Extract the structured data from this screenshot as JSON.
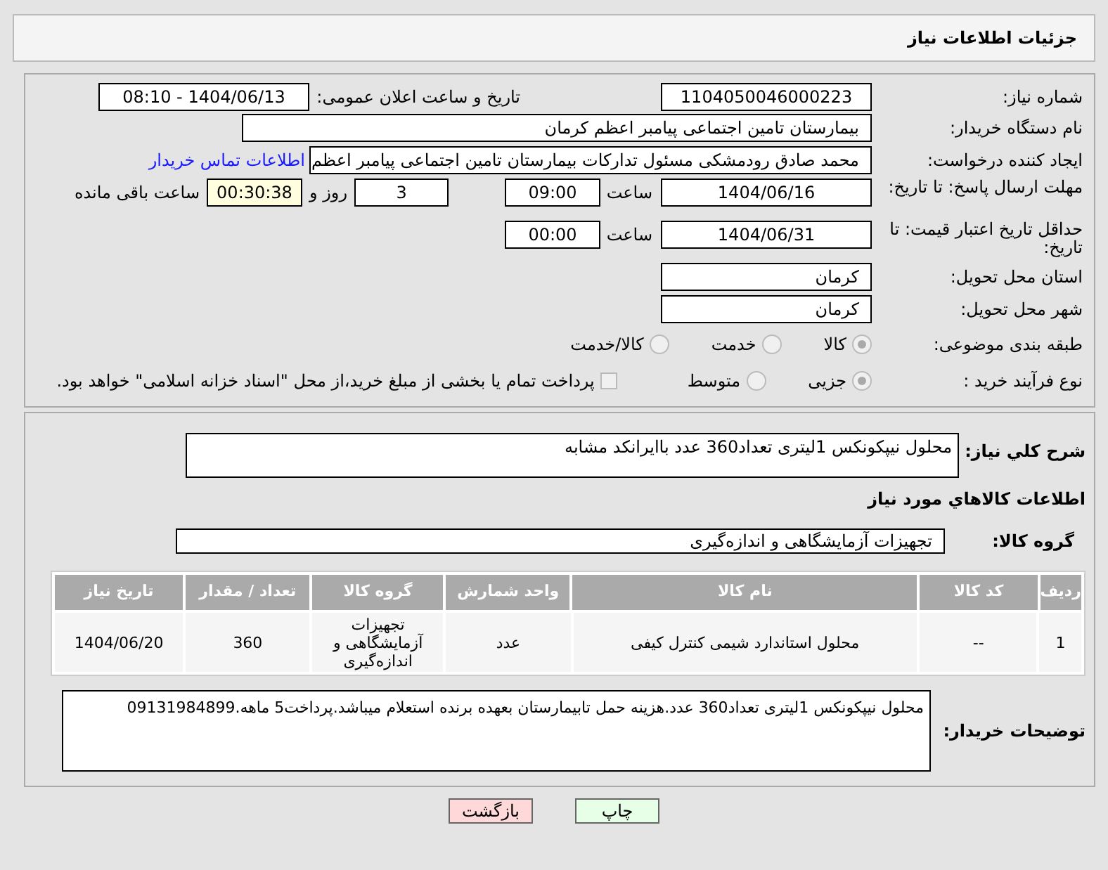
{
  "header": {
    "title": "جزئیات اطلاعات نیاز"
  },
  "need_number": {
    "label": "شماره نیاز:",
    "value": "1104050046000223"
  },
  "announce": {
    "label": "تاریخ و ساعت اعلان عمومی:",
    "value": "1404/06/13 - 08:10"
  },
  "buyer_org": {
    "label": "نام دستگاه خریدار:",
    "value": "بیمارستان تامین اجتماعی پیامبر اعظم کرمان"
  },
  "requester": {
    "label": "ایجاد کننده درخواست:",
    "value": "محمد صادق  رودمشکی مسئول تدارکات بیمارستان تامین اجتماعی پیامبر اعظم",
    "link": "اطلاعات تماس خریدار"
  },
  "reply_deadline": {
    "label": "مهلت ارسال پاسخ: تا تاریخ:",
    "date": "1404/06/16",
    "time_label": "ساعت",
    "time": "09:00",
    "days": "3",
    "days_label": "روز و",
    "remaining": "00:30:38",
    "remaining_label": "ساعت باقی مانده"
  },
  "price_validity": {
    "label": "حداقل تاریخ اعتبار قیمت: تا تاریخ:",
    "date": "1404/06/31",
    "time_label": "ساعت",
    "time": "00:00"
  },
  "province": {
    "label": "استان محل تحویل:",
    "value": "کرمان"
  },
  "city": {
    "label": "شهر محل تحویل:",
    "value": "کرمان"
  },
  "category": {
    "label": "طبقه بندی موضوعی:",
    "options": [
      {
        "label": "کالا",
        "selected": true
      },
      {
        "label": "خدمت",
        "selected": false
      },
      {
        "label": "کالا/خدمت",
        "selected": false
      }
    ]
  },
  "purchase_type": {
    "label": "نوع فرآیند خرید :",
    "options": [
      {
        "label": "جزیی",
        "selected": true
      },
      {
        "label": "متوسط",
        "selected": false
      }
    ],
    "treasury": {
      "label": "پرداخت تمام یا بخشی از مبلغ خرید،از محل \"اسناد خزانه اسلامی\" خواهد بود.",
      "checked": false
    }
  },
  "description": {
    "label": "شرح کلي نياز:",
    "value": "محلول نیپکونکس 1لیتری تعداد360 عدد باایرانکد مشابه"
  },
  "goods_title": "اطلاعات کالاهاي مورد نياز",
  "goods_group": {
    "label": "گروه کالا:",
    "value": "تجهیزات آزمایشگاهی و اندازه‌گیری"
  },
  "table": {
    "columns": [
      "ردیف",
      "کد کالا",
      "نام کالا",
      "واحد شمارش",
      "گروه کالا",
      "تعداد / مقدار",
      "تاریخ نیاز"
    ],
    "rows": [
      [
        "1",
        "--",
        "محلول استاندارد شیمی کنترل کیفی",
        "عدد",
        "تجهیزات آزمایشگاهی و اندازه‌گیری",
        "360",
        "1404/06/20"
      ]
    ]
  },
  "buyer_notes": {
    "label": "توضیحات خریدار:",
    "value": "محلول نیپکونکس 1لیتری تعداد360 عدد.هزینه حمل تابیمارستان بعهده برنده استعلام میباشد.پرداخت5 ماهه.09131984899"
  },
  "buttons": [
    {
      "label": "چاپ",
      "kind": "print"
    },
    {
      "label": "بازگشت",
      "kind": "back"
    }
  ]
}
